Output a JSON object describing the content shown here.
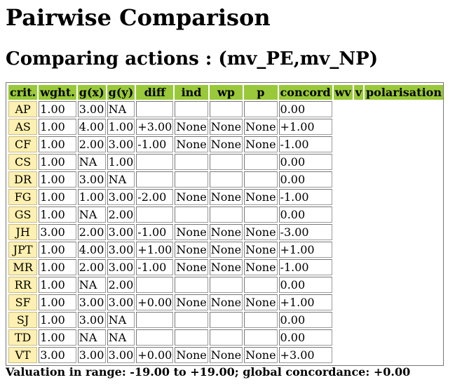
{
  "page": {
    "title": "Pairwise Comparison",
    "subtitle": "Comparing actions : (mv_PE,mv_NP)"
  },
  "table": {
    "headers": [
      "crit.",
      "wght.",
      "g(x)",
      "g(y)",
      "diff",
      "ind",
      "wp",
      "p",
      "concord",
      "wv",
      "v",
      "polarisation"
    ],
    "rows": [
      [
        "AP",
        "1.00",
        "3.00",
        "NA",
        "",
        "",
        "",
        "",
        "0.00"
      ],
      [
        "AS",
        "1.00",
        "4.00",
        "1.00",
        "+3.00",
        "None",
        "None",
        "None",
        "+1.00"
      ],
      [
        "CF",
        "1.00",
        "2.00",
        "3.00",
        "-1.00",
        "None",
        "None",
        "None",
        "-1.00"
      ],
      [
        "CS",
        "1.00",
        "NA",
        "1.00",
        "",
        "",
        "",
        "",
        "0.00"
      ],
      [
        "DR",
        "1.00",
        "3.00",
        "NA",
        "",
        "",
        "",
        "",
        "0.00"
      ],
      [
        "FG",
        "1.00",
        "1.00",
        "3.00",
        "-2.00",
        "None",
        "None",
        "None",
        "-1.00"
      ],
      [
        "GS",
        "1.00",
        "NA",
        "2.00",
        "",
        "",
        "",
        "",
        "0.00"
      ],
      [
        "JH",
        "3.00",
        "2.00",
        "3.00",
        "-1.00",
        "None",
        "None",
        "None",
        "-3.00"
      ],
      [
        "JPT",
        "1.00",
        "4.00",
        "3.00",
        "+1.00",
        "None",
        "None",
        "None",
        "+1.00"
      ],
      [
        "MR",
        "1.00",
        "2.00",
        "3.00",
        "-1.00",
        "None",
        "None",
        "None",
        "-1.00"
      ],
      [
        "RR",
        "1.00",
        "NA",
        "2.00",
        "",
        "",
        "",
        "",
        "0.00"
      ],
      [
        "SF",
        "1.00",
        "3.00",
        "3.00",
        "+0.00",
        "None",
        "None",
        "None",
        "+1.00"
      ],
      [
        "SJ",
        "1.00",
        "3.00",
        "NA",
        "",
        "",
        "",
        "",
        "0.00"
      ],
      [
        "TD",
        "1.00",
        "NA",
        "NA",
        "",
        "",
        "",
        "",
        "0.00"
      ],
      [
        "VT",
        "3.00",
        "3.00",
        "3.00",
        "+0.00",
        "None",
        "None",
        "None",
        "+3.00"
      ]
    ]
  },
  "footer": {
    "text": "Valuation in range: -19.00 to +19.00; global concordance: +0.00"
  },
  "colors": {
    "header_bg": "#99c93a",
    "criterion_bg": "#fdf0b0"
  }
}
